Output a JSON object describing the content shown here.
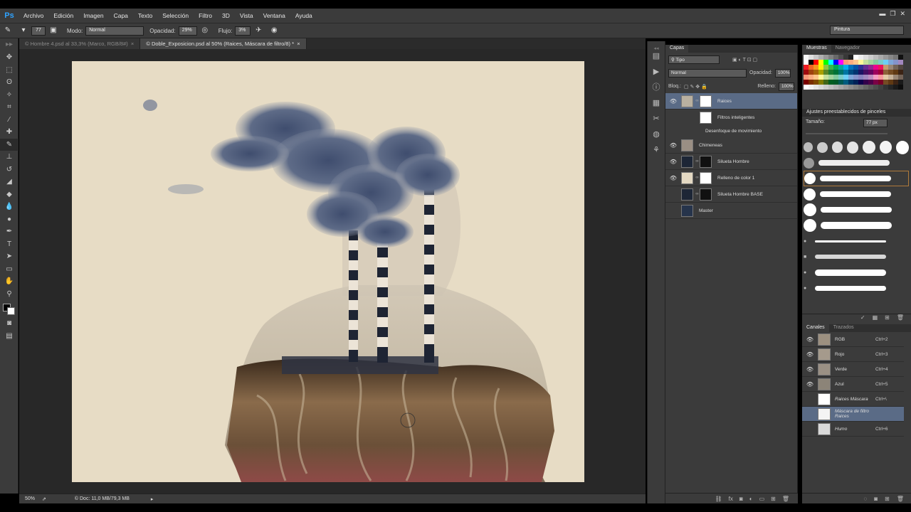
{
  "app": {
    "logo": "Ps"
  },
  "menu": [
    "Archivo",
    "Edición",
    "Imagen",
    "Capa",
    "Texto",
    "Selección",
    "Filtro",
    "3D",
    "Vista",
    "Ventana",
    "Ayuda"
  ],
  "options": {
    "brush_size": "77",
    "mode_label": "Modo:",
    "mode_value": "Normal",
    "opacity_label": "Opacidad:",
    "opacity_value": "29%",
    "flow_label": "Flujo:",
    "flow_value": "3%",
    "workspace": "Pintura"
  },
  "tabs": [
    {
      "label": "Hombre 4.psd al 33,3% (Marco, RGB/8#)",
      "active": false
    },
    {
      "label": "Doble_Exposicion.psd al 50% (Raices, Máscara de filtro/8) *",
      "active": true
    }
  ],
  "status": {
    "zoom": "50%",
    "doc": "Doc: 11,0 MB/79,3 MB"
  },
  "layers_panel": {
    "tabs": [
      "Capas"
    ],
    "filter": "Tipo",
    "blend_mode": "Normal",
    "opacity_label": "Opacidad:",
    "opacity_value": "100%",
    "lock_label": "Bloq.:",
    "fill_label": "Relleno:",
    "fill_value": "100%",
    "layers": [
      {
        "name": "Raices",
        "visible": true,
        "selected": true,
        "thumb": "#b9b0a0",
        "mask": "#ffffff"
      },
      {
        "name": "Chimeneas",
        "visible": true,
        "selected": false,
        "thumb": "#9a8f84",
        "mask": null
      },
      {
        "name": "Silueta Hombre",
        "visible": true,
        "selected": false,
        "thumb": "#1d2636",
        "mask": "#111111"
      },
      {
        "name": "Relleno de color 1",
        "visible": true,
        "selected": false,
        "thumb": "#e4d9c3",
        "mask": "#ffffff"
      },
      {
        "name": "Silueta Hombre BASE",
        "visible": false,
        "selected": false,
        "thumb": "#1d2636",
        "mask": "#111111"
      },
      {
        "name": "Master",
        "visible": false,
        "selected": false,
        "thumb": "#26344b",
        "mask": null
      }
    ],
    "smart_filters_label": "Filtros inteligentes",
    "smart_filter": "Desenfoque de movimiento"
  },
  "swatches_panel": {
    "tabs": [
      "Muestras",
      "Navegador"
    ]
  },
  "brush_presets": {
    "title": "Ajustes preestablecidos de pinceles",
    "size_label": "Tamaño:",
    "size_value": "77 px"
  },
  "channels_panel": {
    "tabs": [
      "Canales",
      "Trazados"
    ],
    "channels": [
      {
        "name": "RGB",
        "shortcut": "Ctrl+2",
        "visible": true,
        "selected": false
      },
      {
        "name": "Rojo",
        "shortcut": "Ctrl+3",
        "visible": true,
        "selected": false
      },
      {
        "name": "Verde",
        "shortcut": "Ctrl+4",
        "visible": true,
        "selected": false
      },
      {
        "name": "Azul",
        "shortcut": "Ctrl+5",
        "visible": true,
        "selected": false
      },
      {
        "name": "Raices Máscara",
        "shortcut": "Ctrl+\\",
        "visible": false,
        "selected": false
      },
      {
        "name": "Máscara de filtro Raices",
        "shortcut": "",
        "visible": false,
        "selected": true
      },
      {
        "name": "Humo",
        "shortcut": "Ctrl+6",
        "visible": false,
        "selected": false
      }
    ]
  },
  "colors": {
    "selection": "#5a6b86",
    "panel": "#3b3b3b",
    "canvas_bg": "#e7dcc5"
  }
}
